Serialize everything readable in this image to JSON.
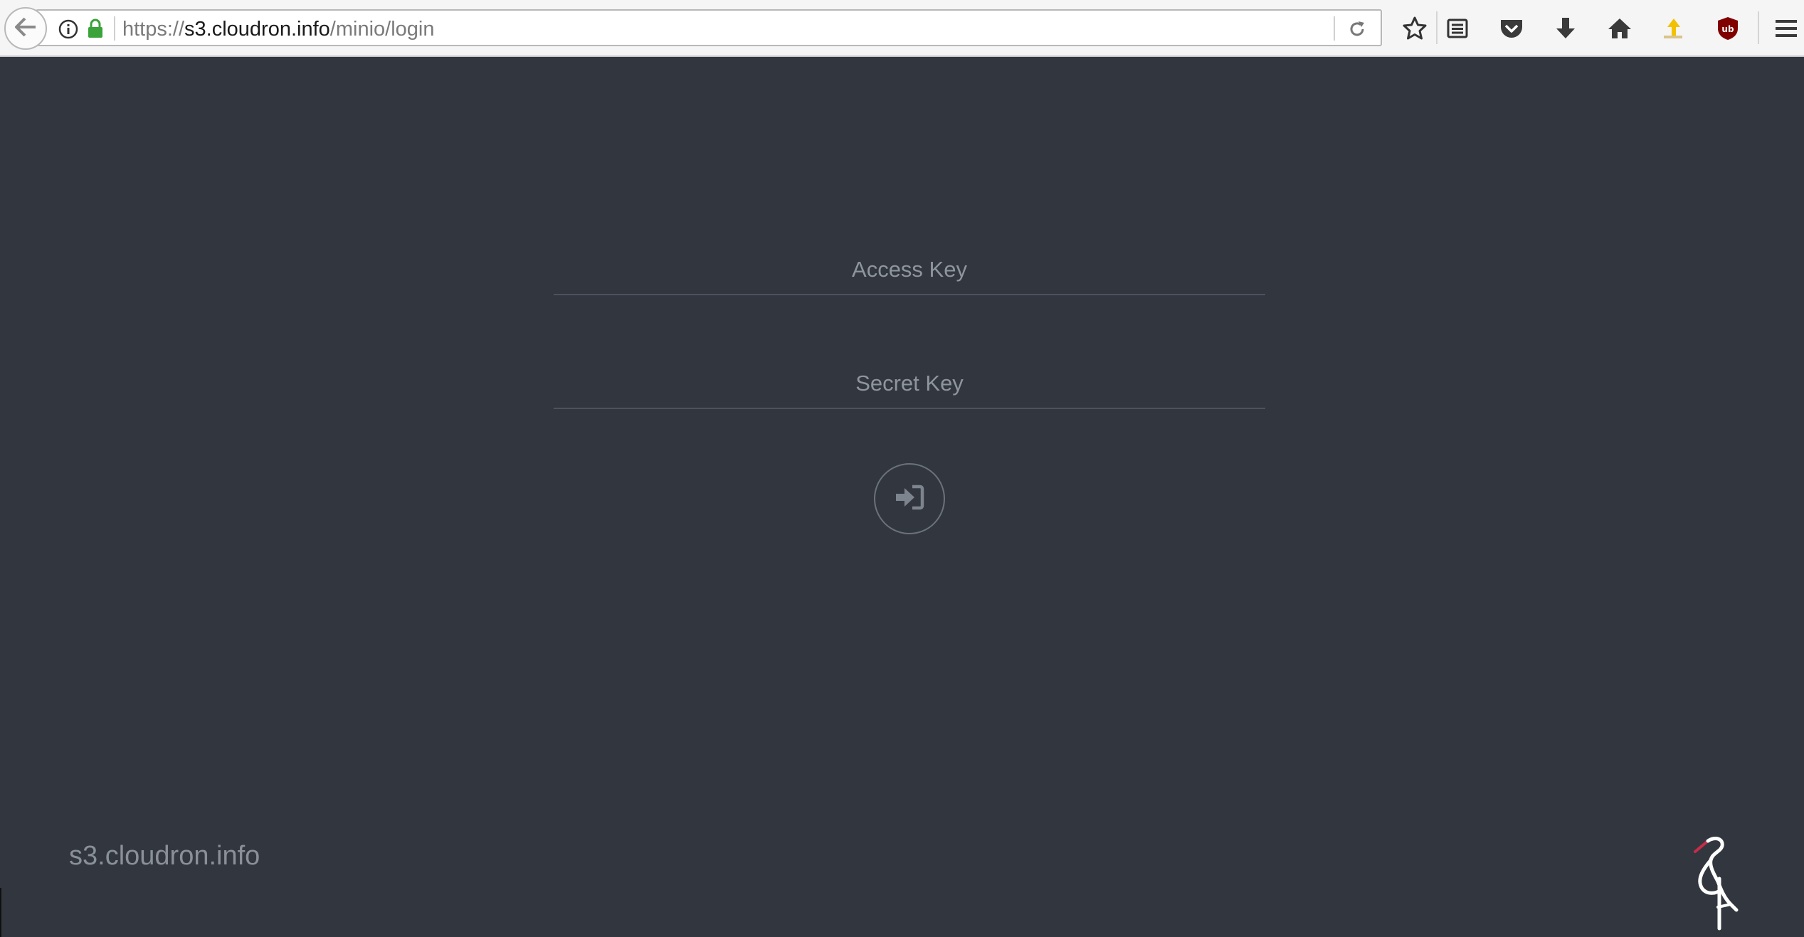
{
  "browser": {
    "url": {
      "scheme": "https://",
      "host": "s3.cloudron.info",
      "path": "/minio/login"
    },
    "icons": {
      "back": "back-arrow-icon",
      "info": "info-icon",
      "lock": "lock-icon",
      "reload": "reload-icon",
      "bookmark": "star-icon",
      "reader": "reading-list-icon",
      "pocket": "pocket-icon",
      "downloads": "download-icon",
      "home": "home-icon",
      "extension": "extension-icon",
      "ublock": "ublock-icon",
      "menu": "hamburger-menu-icon"
    }
  },
  "login": {
    "access_key_placeholder": "Access Key",
    "secret_key_placeholder": "Secret Key",
    "submit_icon": "sign-in-icon"
  },
  "footer": {
    "host": "s3.cloudron.info",
    "logo": "minio-logo"
  },
  "colors": {
    "background": "#32373f",
    "lock_green": "#3aa33a",
    "ublock_red": "#800000",
    "logo_red": "#c72c48"
  }
}
